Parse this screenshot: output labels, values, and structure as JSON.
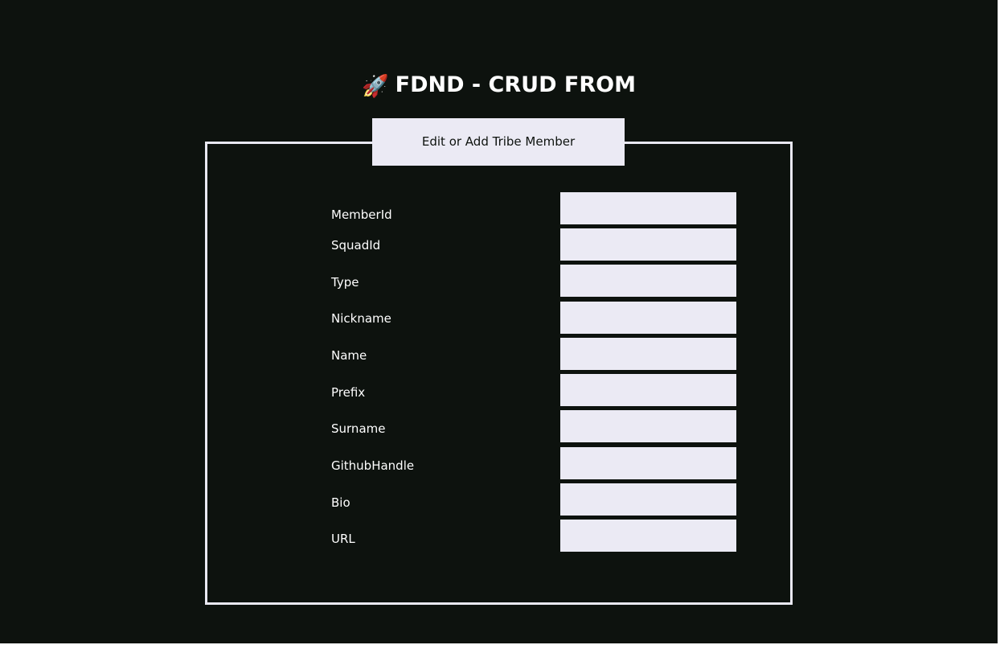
{
  "header": {
    "rocket_icon": "🚀",
    "title": "FDND - CRUD FROM"
  },
  "form": {
    "legend": "Edit or Add Tribe Member",
    "fields": [
      {
        "label": "MemberId",
        "value": ""
      },
      {
        "label": "SquadId",
        "value": ""
      },
      {
        "label": "Type",
        "value": ""
      },
      {
        "label": "Nickname",
        "value": ""
      },
      {
        "label": "Name",
        "value": ""
      },
      {
        "label": "Prefix",
        "value": ""
      },
      {
        "label": "Surname",
        "value": ""
      },
      {
        "label": "GithubHandle",
        "value": ""
      },
      {
        "label": "Bio",
        "value": ""
      },
      {
        "label": "URL",
        "value": ""
      }
    ]
  },
  "colors": {
    "background": "#0d120e",
    "field": "#ebeaf4",
    "border": "#e9e8f2",
    "text": "#ffffff"
  }
}
